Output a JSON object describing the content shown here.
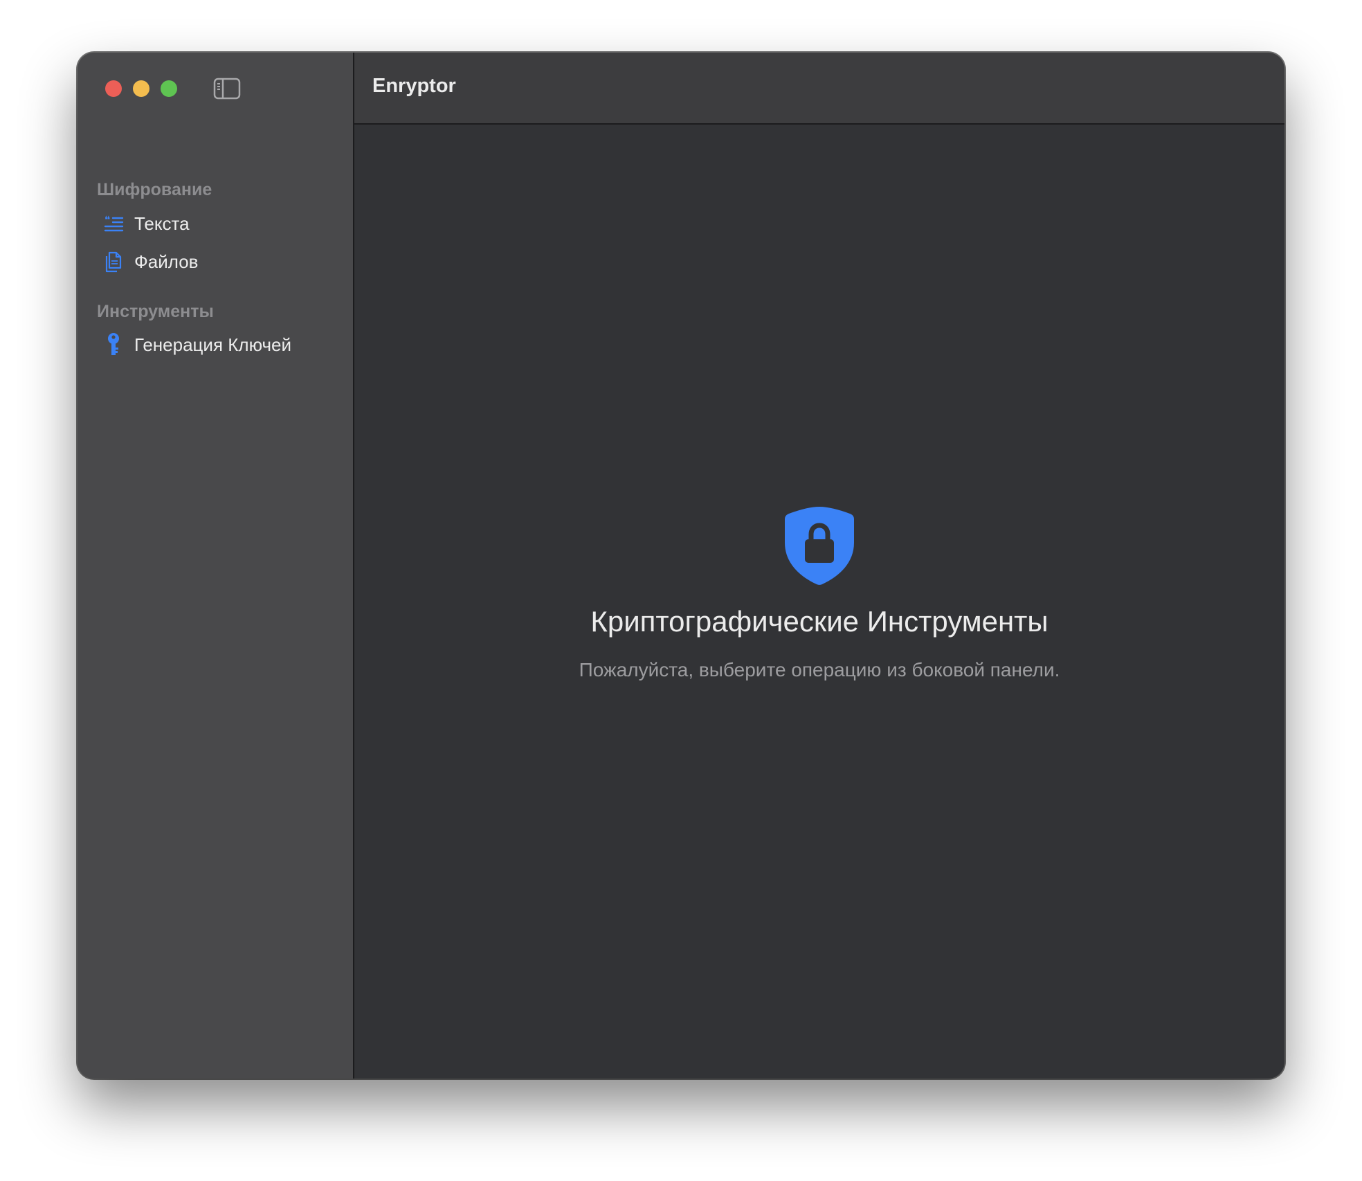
{
  "window": {
    "title": "Enryptor"
  },
  "sidebar": {
    "sections": [
      {
        "header": "Шифрование",
        "items": [
          {
            "label": "Текста",
            "icon": "text-quote-icon"
          },
          {
            "label": "Файлов",
            "icon": "documents-icon"
          }
        ]
      },
      {
        "header": "Инструменты",
        "items": [
          {
            "label": "Генерация Ключей",
            "icon": "key-icon"
          }
        ]
      }
    ]
  },
  "main": {
    "icon": "lock-shield-icon",
    "title": "Криптографические Инструменты",
    "subtitle": "Пожалуйста, выберите операцию из боковой панели."
  },
  "colors": {
    "accent": "#3b82f6",
    "close": "#ec5f57",
    "minimize": "#f4bd4f",
    "zoom": "#5fc452"
  }
}
